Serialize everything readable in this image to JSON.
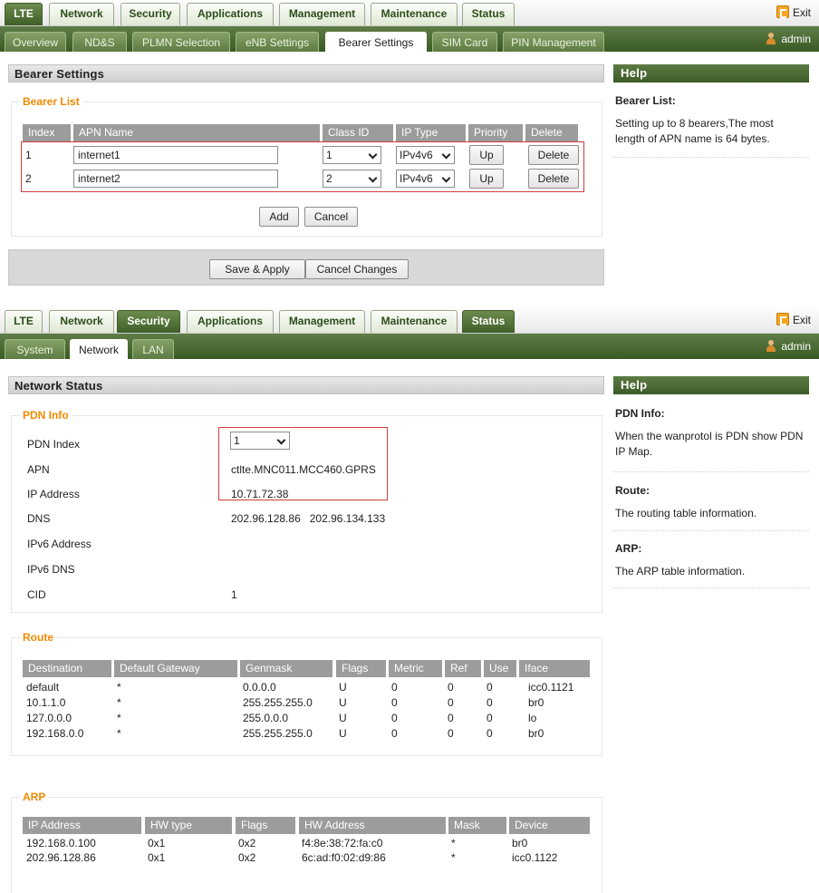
{
  "panel1": {
    "top_tabs": [
      "LTE",
      "Network",
      "Security",
      "Applications",
      "Management",
      "Maintenance",
      "Status"
    ],
    "exit_label": "Exit",
    "sub_tabs": [
      "Overview",
      "ND&S",
      "PLMN Selection",
      "eNB Settings",
      "Bearer Settings",
      "SIM Card",
      "PIN Management"
    ],
    "user": "admin",
    "section_title": "Bearer Settings",
    "help": {
      "title": "Help",
      "topic": "Bearer List:",
      "text": "Setting up to 8 bearers,The most length of APN name is 64 bytes."
    },
    "bearer_list": {
      "legend": "Bearer List",
      "headers": [
        "Index",
        "APN Name",
        "Class ID",
        "IP Type",
        "Priority",
        "Delete"
      ],
      "rows": [
        {
          "index": "1",
          "apn": "internet1",
          "class_id": "1",
          "ip_type": "IPv4v6",
          "priority_btn": "Up",
          "delete_btn": "Delete"
        },
        {
          "index": "2",
          "apn": "internet2",
          "class_id": "2",
          "ip_type": "IPv4v6",
          "priority_btn": "Up",
          "delete_btn": "Delete"
        }
      ],
      "add_label": "Add",
      "cancel_label": "Cancel"
    },
    "save_label": "Save & Apply",
    "cancel_changes_label": "Cancel Changes"
  },
  "panel2": {
    "top_tabs": [
      "LTE",
      "Network",
      "Security",
      "Applications",
      "Management",
      "Maintenance",
      "Status"
    ],
    "exit_label": "Exit",
    "sub_tabs": [
      "System",
      "Network",
      "LAN"
    ],
    "user": "admin",
    "section_title": "Network Status",
    "help": {
      "title": "Help",
      "items": [
        {
          "topic": "PDN Info:",
          "text": "When the wanprotol is PDN show PDN IP Map."
        },
        {
          "topic": "Route:",
          "text": "The routing table information."
        },
        {
          "topic": "ARP:",
          "text": "The ARP table information."
        }
      ]
    },
    "pdn": {
      "legend": "PDN Info",
      "labels": [
        "PDN Index",
        "APN",
        "IP Address",
        "DNS",
        "IPv6 Address",
        "IPv6 DNS",
        "CID"
      ],
      "pdn_index": "1",
      "apn": "ctlte.MNC011.MCC460.GPRS",
      "ip_address": "10.71.72.38",
      "dns": "202.96.128.86   202.96.134.133",
      "ipv6_address": "",
      "ipv6_dns": "",
      "cid": "1"
    },
    "route": {
      "legend": "Route",
      "headers": [
        "Destination",
        "Default Gateway",
        "Genmask",
        "Flags",
        "Metric",
        "Ref",
        "Use",
        "Iface"
      ],
      "rows": [
        [
          "default",
          "*",
          "0.0.0.0",
          "U",
          "0",
          "0",
          "0",
          "icc0.1121"
        ],
        [
          "10.1.1.0",
          "*",
          "255.255.255.0",
          "U",
          "0",
          "0",
          "0",
          "br0"
        ],
        [
          "127.0.0.0",
          "*",
          "255.0.0.0",
          "U",
          "0",
          "0",
          "0",
          "lo"
        ],
        [
          "192.168.0.0",
          "*",
          "255.255.255.0",
          "U",
          "0",
          "0",
          "0",
          "br0"
        ]
      ]
    },
    "arp": {
      "legend": "ARP",
      "headers": [
        "IP Address",
        "HW type",
        "Flags",
        "HW Address",
        "Mask",
        "Device"
      ],
      "rows": [
        [
          "192.168.0.100",
          "0x1",
          "0x2",
          "f4:8e:38:72:fa:c0",
          "*",
          "br0"
        ],
        [
          "202.96.128.86",
          "0x1",
          "0x2",
          "6c:ad:f0:02:d9:86",
          "*",
          "icc0.1122"
        ]
      ]
    }
  }
}
